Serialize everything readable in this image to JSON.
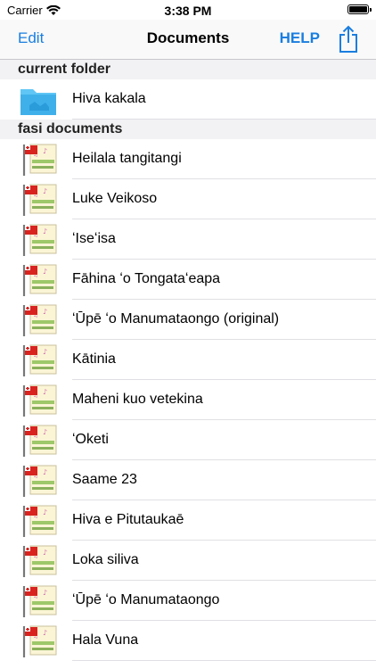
{
  "status_bar": {
    "carrier": "Carrier",
    "time": "3:38 PM",
    "battery_level": 1.0
  },
  "nav": {
    "edit_label": "Edit",
    "title": "Documents",
    "help_label": "HELP",
    "share_icon": "share-icon"
  },
  "sections": [
    {
      "header": "current folder",
      "items": [
        {
          "label": "Hiva kakala",
          "icon": "folder-icon"
        }
      ]
    },
    {
      "header": "fasi documents",
      "items": [
        {
          "label": "Heilala tangitangi",
          "icon": "document-icon"
        },
        {
          "label": "Luke Veikoso",
          "icon": "document-icon"
        },
        {
          "label": "ʻIseʻisa",
          "icon": "document-icon"
        },
        {
          "label": "Fāhina ʻo Tongataʻeapa",
          "icon": "document-icon"
        },
        {
          "label": "ʻŪpē ʻo Manumataongo (original)",
          "icon": "document-icon"
        },
        {
          "label": "Kātinia",
          "icon": "document-icon"
        },
        {
          "label": "Maheni kuo vetekina",
          "icon": "document-icon"
        },
        {
          "label": "ʻOketi",
          "icon": "document-icon"
        },
        {
          "label": "Saame 23",
          "icon": "document-icon"
        },
        {
          "label": "Hiva e Pitutaukaē",
          "icon": "document-icon"
        },
        {
          "label": "Loka siliva",
          "icon": "document-icon"
        },
        {
          "label": "ʻŪpē ʻo Manumataongo",
          "icon": "document-icon"
        },
        {
          "label": "Hala Vuna",
          "icon": "document-icon"
        }
      ]
    }
  ],
  "colors": {
    "accent": "#1a7ee0",
    "flag_red": "#d8231f",
    "folder_blue": "#3fb0ea"
  }
}
